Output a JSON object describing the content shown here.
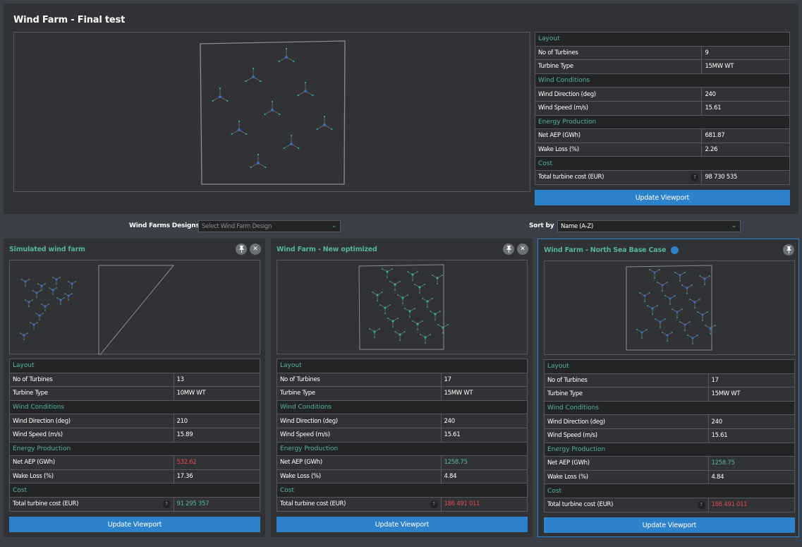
{
  "main": {
    "title": "Wind Farm - Final test",
    "properties": {
      "sections": {
        "layout": "Layout",
        "wind": "Wind Conditions",
        "energy": "Energy Production",
        "cost": "Cost"
      },
      "labels": {
        "turbines": "No of Turbines",
        "type": "Turbine Type",
        "direction": "Wind Direction (deg)",
        "speed": "Wind Speed (m/s)",
        "aep": "Net AEP (GWh)",
        "wake": "Wake Loss (%)",
        "cost": "Total turbine cost (EUR)"
      },
      "values": {
        "turbines": "9",
        "type": "15MW WT",
        "direction": "240",
        "speed": "15.61",
        "aep": "681.87",
        "wake": "2.26",
        "cost": "98 730 535"
      }
    },
    "update_label": "Update Viewport",
    "help_glyph": "?"
  },
  "filters": {
    "designs_label": "Wind Farms Designs",
    "designs_placeholder": "Select Wind Farm Design",
    "sort_label": "Sort by",
    "sort_value": "Name (A-Z)",
    "chevron": "⌄"
  },
  "icons": {
    "pin": "pin-icon",
    "close": "close-icon",
    "status": "status-dot-icon",
    "help": "help-icon",
    "chevron": "chevron-down-icon"
  },
  "cards": [
    {
      "title": "Simulated wind farm",
      "turbines": "13",
      "type": "10MW WT",
      "direction": "210",
      "speed": "15.89",
      "aep": "532.62",
      "aep_status": "bad",
      "wake": "17.36",
      "cost": "91 295 357",
      "cost_status": "good",
      "closable": true,
      "active": false
    },
    {
      "title": "Wind Farm - New optimized",
      "turbines": "17",
      "type": "15MW WT",
      "direction": "240",
      "speed": "15.61",
      "aep": "1258.75",
      "aep_status": "good",
      "wake": "4.84",
      "cost": "186 491 011",
      "cost_status": "bad",
      "closable": true,
      "active": false
    },
    {
      "title": "Wind Farm - North Sea Base Case",
      "turbines": "17",
      "type": "15MW WT",
      "direction": "240",
      "speed": "15.61",
      "aep": "1258.75",
      "aep_status": "good",
      "wake": "4.84",
      "cost": "186 491 011",
      "cost_status": "bad",
      "closable": false,
      "active": true
    }
  ],
  "colors": {
    "accent": "#2e82cc",
    "teal": "#56b3a0",
    "bad": "#e5484d",
    "panel": "#303235",
    "background": "#3b4048"
  }
}
